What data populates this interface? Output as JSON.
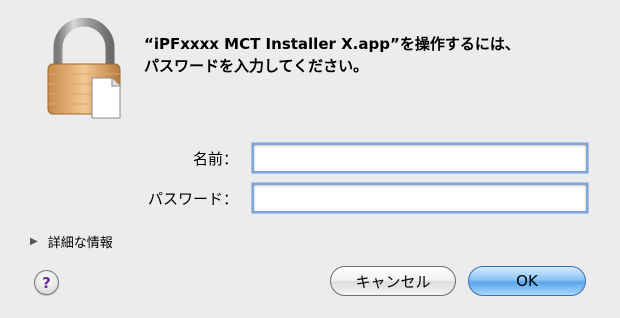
{
  "dialog": {
    "message": "“iPFxxxx MCT Installer X.app”を操作するには、\nパスワードを入力してください。"
  },
  "fields": {
    "name_label": "名前：",
    "name_value": "",
    "password_label": "パスワード：",
    "password_value": ""
  },
  "details": {
    "label": "詳細な情報"
  },
  "buttons": {
    "help": "?",
    "cancel": "キャンセル",
    "ok": "OK"
  },
  "colors": {
    "background": "#ececec",
    "focus_ring": "#7ea6d6",
    "default_button": "#5ba6ea",
    "help_glyph": "#6a2aa8"
  },
  "icons": {
    "lock": "lock-icon",
    "disclosure": "disclosure-triangle-icon"
  }
}
